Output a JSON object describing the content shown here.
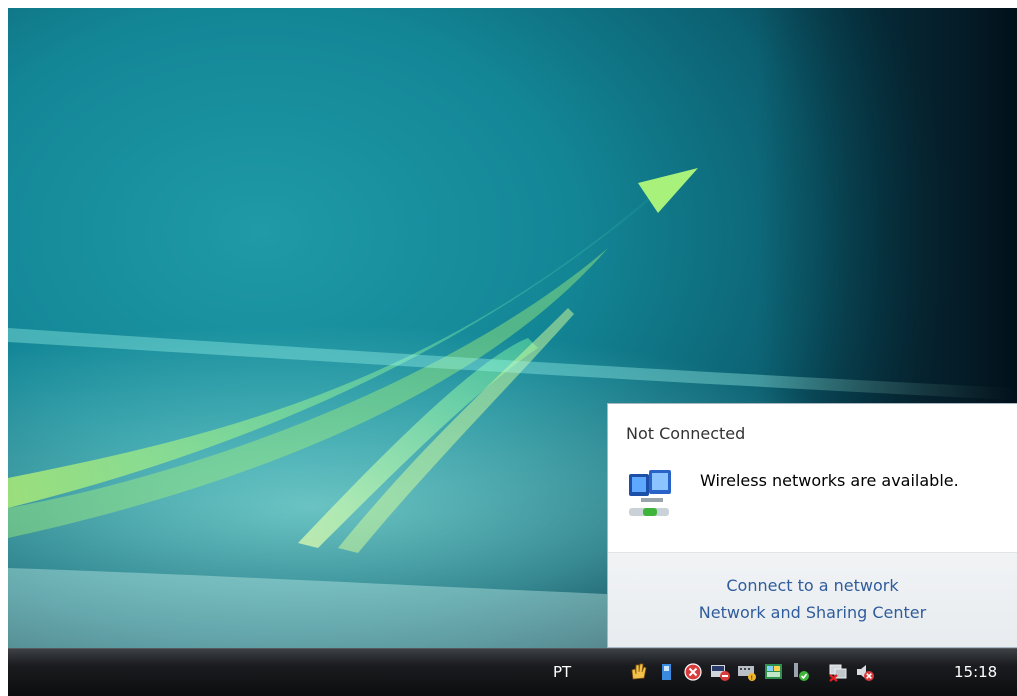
{
  "notification": {
    "title": "Not Connected",
    "message": "Wireless networks are available.",
    "links": {
      "connect": "Connect to a network",
      "sharing_center": "Network and Sharing Center"
    }
  },
  "taskbar": {
    "language": "PT",
    "clock": "15:18",
    "tray_icons": [
      "hand-icon",
      "usb-device-icon",
      "shield-x-icon",
      "antivirus-icon",
      "keyboard-icon",
      "window-icon",
      "sync-check-icon",
      "network-disconnected-icon",
      "speaker-muted-icon"
    ]
  }
}
